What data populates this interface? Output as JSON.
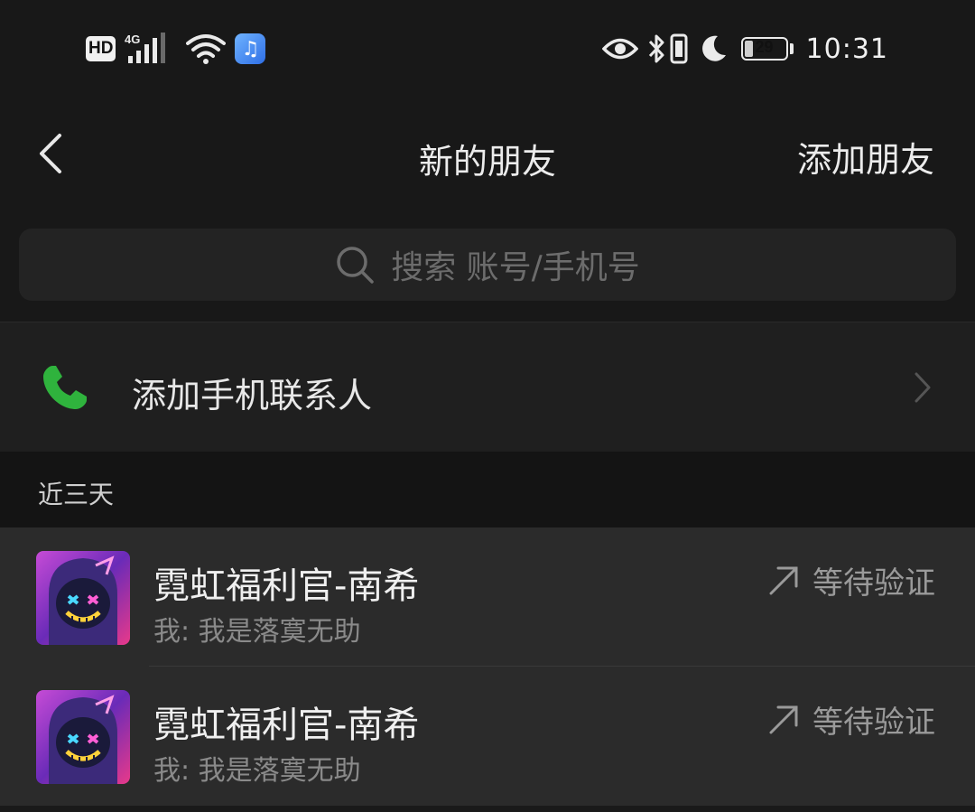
{
  "status_bar": {
    "hd_badge": "HD",
    "network": "4G",
    "battery_level": "29",
    "battery_fraction": 0.29,
    "time": "10:31",
    "icons": [
      "signal-icon",
      "wifi-icon",
      "music-app-icon",
      "eye-icon",
      "bluetooth-icon",
      "vibrate-icon",
      "moon-icon",
      "battery-icon"
    ]
  },
  "nav": {
    "title": "新的朋友",
    "action": "添加朋友"
  },
  "search": {
    "placeholder": "搜索 账号/手机号"
  },
  "add_contacts": {
    "label": "添加手机联系人"
  },
  "section": {
    "label": "近三天"
  },
  "requests": [
    {
      "name": "霓虹福利官-南希",
      "message": "我: 我是落寞无助",
      "status": "等待验证"
    },
    {
      "name": "霓虹福利官-南希",
      "message": "我: 我是落寞无助",
      "status": "等待验证"
    }
  ],
  "colors": {
    "background": "#181818",
    "row": "#2b2b2b",
    "phone_green": "#2fb33d"
  }
}
